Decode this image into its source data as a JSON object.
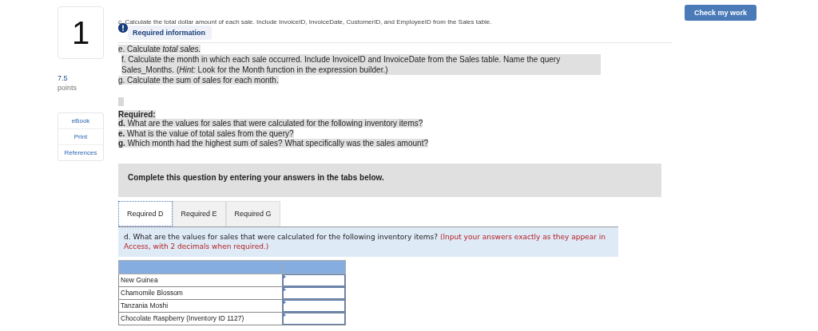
{
  "question": {
    "number": "1",
    "points": "7.5",
    "points_label": "points"
  },
  "resources": [
    "eBook",
    "Print",
    "References"
  ],
  "check_button": "Check my work",
  "intro_line": "c. Calculate the total dollar amount of each sale. Include InvoiceID, InvoiceDate, CustomerID, and EmployeeID from the Sales table.",
  "required_info": "Required information",
  "steps": [
    "e. Calculate *total sales.*",
    "f. Calculate the month in which each sale occurred. Include InvoiceID and InvoiceDate from the Sales table. Name the query Sales_Months. (*Hint:* Look for the Month function in the expression builder.)",
    "g. Calculate the sum of sales for each month."
  ],
  "required_heading": "Required:",
  "required_items": [
    "**d.** What are the values for sales that were calculated for the following inventory items?",
    "**e.** What is the value of total sales from the query?",
    "**g.** Which month had the highest sum of sales? What specifically was the sales amount?"
  ],
  "instruction": "Complete this question by entering your answers in the tabs below.",
  "tabs": [
    {
      "label": "Required D",
      "selected": true
    },
    {
      "label": "Required E",
      "selected": false
    },
    {
      "label": "Required G",
      "selected": false
    }
  ],
  "prompt": {
    "text": "d. What are the values for sales that were calculated for the following inventory items?",
    "note": "(Input your answers exactly as they appear in Access, with 2 decimals when required.)"
  },
  "table": {
    "rows": [
      {
        "item": "New Guinea"
      },
      {
        "item": "Chamomile Blossom"
      },
      {
        "item": "Tanzania Moshi"
      },
      {
        "item": "Chocolate Raspberry (Inventory ID 1127)"
      }
    ]
  }
}
